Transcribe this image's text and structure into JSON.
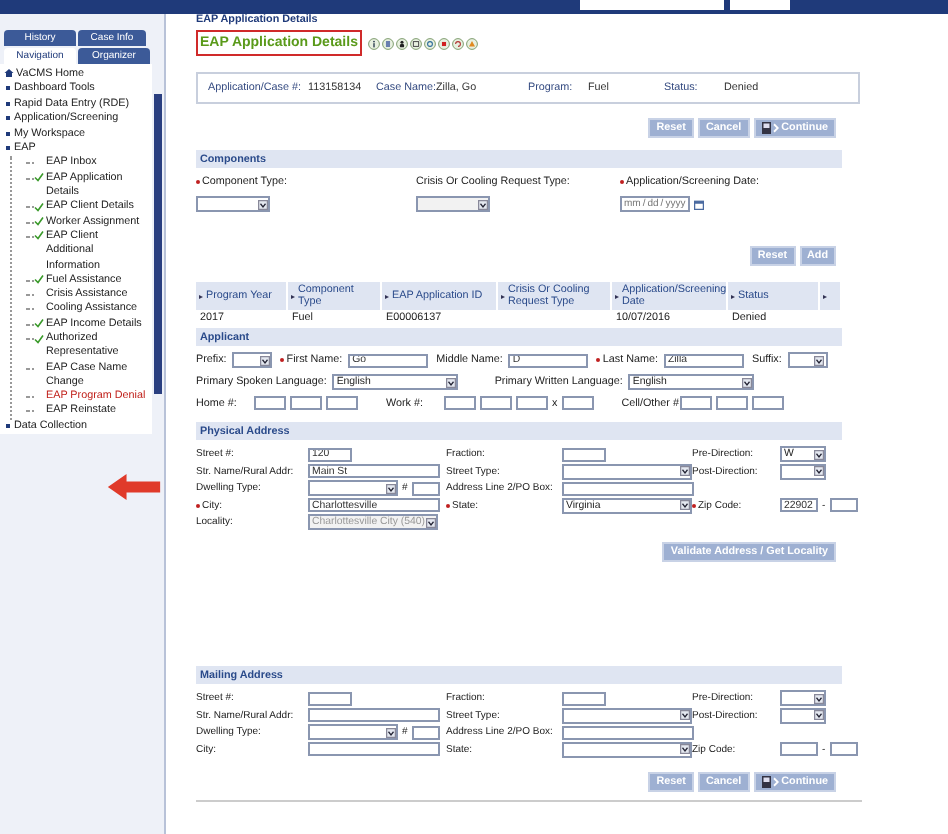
{
  "sidebar": {
    "tabs": [
      {
        "label": "History",
        "selected": false
      },
      {
        "label": "Case Info",
        "selected": false
      },
      {
        "label": "Navigation",
        "selected": true
      },
      {
        "label": "Organizer",
        "selected": false
      }
    ],
    "items": [
      {
        "label": "VaCMS Home",
        "kind": "home",
        "selected": false
      },
      {
        "label": "Dashboard Tools",
        "kind": "bullet",
        "selected": false
      },
      {
        "label": "Rapid Data Entry (RDE)",
        "kind": "bullet",
        "selected": false
      },
      {
        "label": "Application/Screening",
        "kind": "bullet",
        "selected": false
      },
      {
        "label": "My Workspace",
        "kind": "bullet",
        "selected": false
      },
      {
        "label": "EAP",
        "kind": "bullet",
        "selected": false,
        "children": [
          {
            "label": "EAP Inbox",
            "checked": false,
            "selected": false
          },
          {
            "label": "EAP Application Details",
            "checked": true,
            "selected": false
          },
          {
            "label": "EAP Client Details",
            "checked": true,
            "selected": false
          },
          {
            "label": "Worker Assignment",
            "checked": true,
            "selected": false
          },
          {
            "label": "EAP Client Additional Information",
            "checked": true,
            "selected": false
          },
          {
            "label": "Fuel Assistance",
            "checked": true,
            "selected": false
          },
          {
            "label": "Crisis Assistance",
            "checked": false,
            "selected": false
          },
          {
            "label": "Cooling Assistance",
            "checked": false,
            "selected": false
          },
          {
            "label": "EAP Income Details",
            "checked": true,
            "selected": false
          },
          {
            "label": "Authorized Representative",
            "checked": true,
            "selected": false
          },
          {
            "label": "EAP Case Name Change",
            "checked": false,
            "selected": false
          },
          {
            "label": "EAP Program Denial",
            "checked": false,
            "selected": true
          },
          {
            "label": "EAP Reinstate",
            "checked": false,
            "selected": false
          }
        ]
      },
      {
        "label": "Data Collection",
        "kind": "bullet",
        "selected": false
      }
    ]
  },
  "breadcrumb": "EAP Application Details",
  "page_title": "EAP Application Details",
  "summary": [
    {
      "label": "Application/Case #:",
      "value": "113158134"
    },
    {
      "label": "Case Name:",
      "value": "Zilla, Go"
    },
    {
      "label": "Program:",
      "value": "Fuel"
    },
    {
      "label": "Status:",
      "value": "Denied"
    }
  ],
  "top_buttons": [
    {
      "label": "Reset",
      "kind": "plain"
    },
    {
      "label": "Cancel",
      "kind": "plain"
    },
    {
      "label": "Continue",
      "kind": "continue"
    }
  ],
  "sections": [
    {
      "kind": "stacked",
      "title": "Components",
      "rows": [
        {
          "fields": [
            {
              "label": "Component Type:",
              "required": true,
              "kind": "select"
            },
            {
              "label": "Crisis Or Cooling Request Type:",
              "required": false,
              "kind": "locked-select"
            },
            {
              "label": "Application/Screening Date:",
              "required": true,
              "kind": "date",
              "placeholders": [
                "mm",
                "dd",
                "yyyy"
              ],
              "separator": "/"
            }
          ]
        }
      ],
      "buttons": [
        {
          "label": "Reset",
          "kind": "plain"
        },
        {
          "label": "Add",
          "kind": "plain"
        }
      ],
      "table": {
        "columns": [
          "Program Year",
          "Component Type",
          "EAP Application ID",
          "Crisis Or Cooling Request Type",
          "Application/Screening Date",
          "Status"
        ],
        "rows": [
          [
            "2017",
            "Fuel",
            "E00006137",
            null,
            "10/07/2016",
            "Denied"
          ]
        ]
      }
    },
    {
      "kind": "applicant",
      "title": "Applicant",
      "rows": [
        {
          "fields": [
            {
              "label": "Prefix:",
              "required": false,
              "kind": "small-select"
            },
            {
              "label": "First Name:",
              "required": true,
              "kind": "text",
              "value": "Go"
            },
            {
              "label": "Middle Name:",
              "required": false,
              "kind": "text",
              "value": "D"
            },
            {
              "label": "Last Name:",
              "required": true,
              "kind": "text",
              "value": "Zilla"
            },
            {
              "label": "Suffix:",
              "required": false,
              "kind": "small-select"
            }
          ]
        },
        {
          "fields": [
            {
              "label": "Primary Spoken Language:",
              "required": false,
              "kind": "select",
              "value": "English"
            },
            {
              "label": "Primary Written Language:",
              "required": false,
              "kind": "select",
              "value": "English"
            }
          ]
        },
        {
          "fields": [
            {
              "label": "Home #:",
              "required": false,
              "kind": "phone"
            },
            {
              "label": "Work #:",
              "required": false,
              "kind": "phone-ext",
              "ext_label": "x"
            },
            {
              "label": "Cell/Other #:",
              "required": false,
              "kind": "phone"
            }
          ]
        }
      ]
    },
    {
      "kind": "address",
      "title": "Physical Address",
      "rows": [
        {
          "fields": [
            {
              "label": "Street #:",
              "required": false,
              "kind": "short",
              "value": "120"
            },
            {
              "label": "Fraction:",
              "required": false,
              "kind": "short"
            },
            {
              "label": "Pre-Direction:",
              "required": false,
              "kind": "small-select",
              "value": "W"
            }
          ]
        },
        {
          "fields": [
            {
              "label": "Str. Name/Rural Addr:",
              "required": false,
              "kind": "text",
              "value": "Main St"
            },
            {
              "label": "Street Type:",
              "required": false,
              "kind": "select"
            },
            {
              "label": "Post-Direction:",
              "required": false,
              "kind": "small-select"
            }
          ]
        },
        {
          "fields": [
            {
              "label": "Dwelling Type:",
              "required": false,
              "kind": "dwelling",
              "hash_label": "#"
            },
            {
              "label": "Address Line 2/PO Box:",
              "required": false,
              "kind": "text"
            }
          ]
        },
        {
          "fields": [
            {
              "label": "City:",
              "required": true,
              "kind": "text",
              "value": "Charlottesville"
            },
            {
              "label": "State:",
              "required": true,
              "kind": "select",
              "value": "Virginia"
            },
            {
              "label": "Zip Code:",
              "required": true,
              "kind": "zip",
              "value": "22902",
              "separator": "-"
            }
          ]
        },
        {
          "fields": [
            {
              "label": "Locality:",
              "required": false,
              "kind": "locked-select",
              "value": "Charlottesville City (540)"
            }
          ]
        }
      ],
      "buttons": [
        {
          "label": "Validate Address / Get Locality",
          "kind": "plain"
        }
      ]
    },
    {
      "kind": "address",
      "title": "Mailing Address",
      "rows": [
        {
          "fields": [
            {
              "label": "Street #:",
              "required": false,
              "kind": "short"
            },
            {
              "label": "Fraction:",
              "required": false,
              "kind": "short"
            },
            {
              "label": "Pre-Direction:",
              "required": false,
              "kind": "small-select"
            }
          ]
        },
        {
          "fields": [
            {
              "label": "Str. Name/Rural Addr:",
              "required": false,
              "kind": "text"
            },
            {
              "label": "Street Type:",
              "required": false,
              "kind": "select"
            },
            {
              "label": "Post-Direction:",
              "required": false,
              "kind": "small-select"
            }
          ]
        },
        {
          "fields": [
            {
              "label": "Dwelling Type:",
              "required": false,
              "kind": "dwelling",
              "hash_label": "#"
            },
            {
              "label": "Address Line 2/PO Box:",
              "required": false,
              "kind": "text"
            }
          ]
        },
        {
          "fields": [
            {
              "label": "City:",
              "required": false,
              "kind": "text"
            },
            {
              "label": "State:",
              "required": false,
              "kind": "select"
            },
            {
              "label": "Zip Code:",
              "required": false,
              "kind": "zip",
              "separator": "-"
            }
          ]
        }
      ],
      "buttons": [
        {
          "label": "Reset",
          "kind": "plain"
        },
        {
          "label": "Cancel",
          "kind": "plain"
        },
        {
          "label": "Continue",
          "kind": "continue"
        }
      ]
    }
  ]
}
